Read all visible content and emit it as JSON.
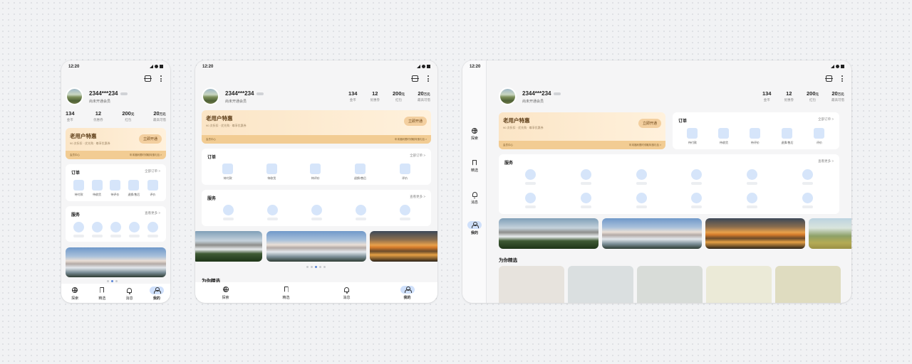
{
  "status": {
    "time": "12:20"
  },
  "user": {
    "name": "2344***234",
    "subtitle": "尚未开通会员"
  },
  "stats": [
    {
      "value": "134",
      "unit": "",
      "label": "金币"
    },
    {
      "value": "12",
      "unit": "",
      "label": "优惠券"
    },
    {
      "value": "200",
      "unit": "元",
      "label": "红包"
    },
    {
      "value": "20",
      "unit": "万元",
      "label": "最高可借"
    }
  ],
  "promo": {
    "title": "老用户特惠",
    "subtitle": "90 次折扣 · 优先购 · 尊享优惠券",
    "button": "立即开通",
    "footer_left": "会员中心",
    "footer_right": "年末福利限时领取特惠礼包 >"
  },
  "orders": {
    "title": "订单",
    "link": "全部订单 >",
    "items": [
      "待付款",
      "待收货",
      "待评价",
      "退换/售后",
      "评价"
    ]
  },
  "services": {
    "title": "服务",
    "link": "查看更多 >"
  },
  "picks": {
    "title": "为你精选"
  },
  "nav": [
    {
      "label": "探索",
      "icon": "globe-icon"
    },
    {
      "label": "精选",
      "icon": "bookmark-icon"
    },
    {
      "label": "消息",
      "icon": "bell-icon"
    },
    {
      "label": "我的",
      "icon": "person-icon",
      "active": true
    }
  ],
  "colors": {
    "accent": "#cfe0fb",
    "placeholder": "#d6e5fa",
    "promo_gold": "#f2cc93",
    "promo_text": "#5a3a14"
  }
}
